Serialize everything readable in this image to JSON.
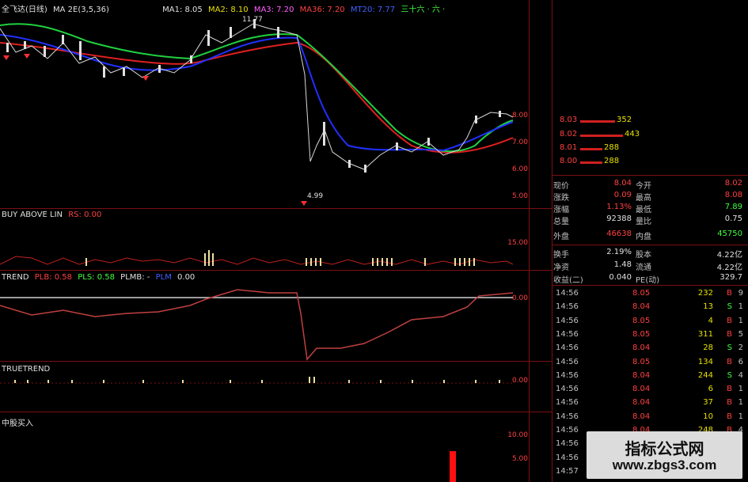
{
  "main_panel": {
    "title": "全飞达(日线)",
    "indicator": "MA 2E(3,5,36)",
    "ma1": "MA1: 8.05",
    "ma2": "MA2: 8.10",
    "ma3": "MA3: 7.20",
    "ma36": "MA36: 7.20",
    "ma_extra": "MT20: 7.77",
    "cn_tag": "三十六 · 六 ·",
    "high_label": "11.77",
    "low_label": "4.99",
    "axis": [
      "8.00",
      "7.00",
      "6.00",
      "5.00"
    ]
  },
  "panel2": {
    "title": "BUY ABOVE LIN",
    "rs": "RS: 0.00",
    "axis": [
      "15.00"
    ]
  },
  "panel3": {
    "title": "TREND",
    "plb": "PLB: 0.58",
    "pls": "PLS: 0.58",
    "plmb": "PLMB: -",
    "plmb2": "PLM",
    "val": "0.00",
    "axis": [
      "0.00"
    ]
  },
  "panel4": {
    "title": "TRUETREND",
    "axis": [
      "0.00"
    ]
  },
  "panel5": {
    "title": "中股买入",
    "axis": [
      "10.00",
      "5.00"
    ]
  },
  "order_book": [
    {
      "price": "8.03",
      "vol": "352"
    },
    {
      "price": "8.02",
      "vol": "443"
    },
    {
      "price": "8.01",
      "vol": "288"
    },
    {
      "price": "8.00",
      "vol": "288"
    }
  ],
  "quote": [
    {
      "l1": "现价",
      "v1": "8.04",
      "l2": "今开",
      "v2": "8.02"
    },
    {
      "l1": "涨跌",
      "v1": "0.09",
      "l2": "最高",
      "v2": "8.08"
    },
    {
      "l1": "涨幅",
      "v1": "1.13%",
      "l2": "最低",
      "v2": "7.89"
    },
    {
      "l1": "总量",
      "v1": "92388",
      "l2": "量比",
      "v2": "0.75"
    },
    {
      "l1": "外盘",
      "v1": "46638",
      "l2": "内盘",
      "v2": "45750"
    },
    {
      "l1": "换手",
      "v1": "2.19%",
      "l2": "股本",
      "v2": "4.22亿"
    },
    {
      "l1": "净资",
      "v1": "1.48",
      "l2": "流通",
      "v2": "4.22亿"
    },
    {
      "l1": "收益(二)",
      "v1": "0.040",
      "l2": "PE(动)",
      "v2": "329.7"
    }
  ],
  "trades": [
    {
      "time": "14:56",
      "price": "8.05",
      "qty": "232",
      "bs": "B",
      "cnt": "9"
    },
    {
      "time": "14:56",
      "price": "8.04",
      "qty": "13",
      "bs": "S",
      "cnt": "1"
    },
    {
      "time": "14:56",
      "price": "8.05",
      "qty": "4",
      "bs": "B",
      "cnt": "1"
    },
    {
      "time": "14:56",
      "price": "8.05",
      "qty": "311",
      "bs": "B",
      "cnt": "5"
    },
    {
      "time": "14:56",
      "price": "8.04",
      "qty": "28",
      "bs": "S",
      "cnt": "2"
    },
    {
      "time": "14:56",
      "price": "8.05",
      "qty": "134",
      "bs": "B",
      "cnt": "6"
    },
    {
      "time": "14:56",
      "price": "8.04",
      "qty": "244",
      "bs": "S",
      "cnt": "4"
    },
    {
      "time": "14:56",
      "price": "8.04",
      "qty": "6",
      "bs": "B",
      "cnt": "1"
    },
    {
      "time": "14:56",
      "price": "8.04",
      "qty": "37",
      "bs": "B",
      "cnt": "1"
    },
    {
      "time": "14:56",
      "price": "8.04",
      "qty": "10",
      "bs": "B",
      "cnt": "1"
    },
    {
      "time": "14:56",
      "price": "8.04",
      "qty": "248",
      "bs": "B",
      "cnt": "4"
    },
    {
      "time": "14:56",
      "price": "",
      "qty": "",
      "bs": "",
      "cnt": ""
    },
    {
      "time": "14:56",
      "price": "",
      "qty": "",
      "bs": "",
      "cnt": ""
    },
    {
      "time": "14:57",
      "price": "",
      "qty": "",
      "bs": "",
      "cnt": ""
    }
  ],
  "watermark": {
    "line1": "指标公式网",
    "line2": "www.zbgs3.com"
  },
  "colors": {
    "red": "#ff4040",
    "green": "#40ff40",
    "blue": "#2030ff",
    "yellow": "#e8e000",
    "grid": "#7a1010"
  }
}
